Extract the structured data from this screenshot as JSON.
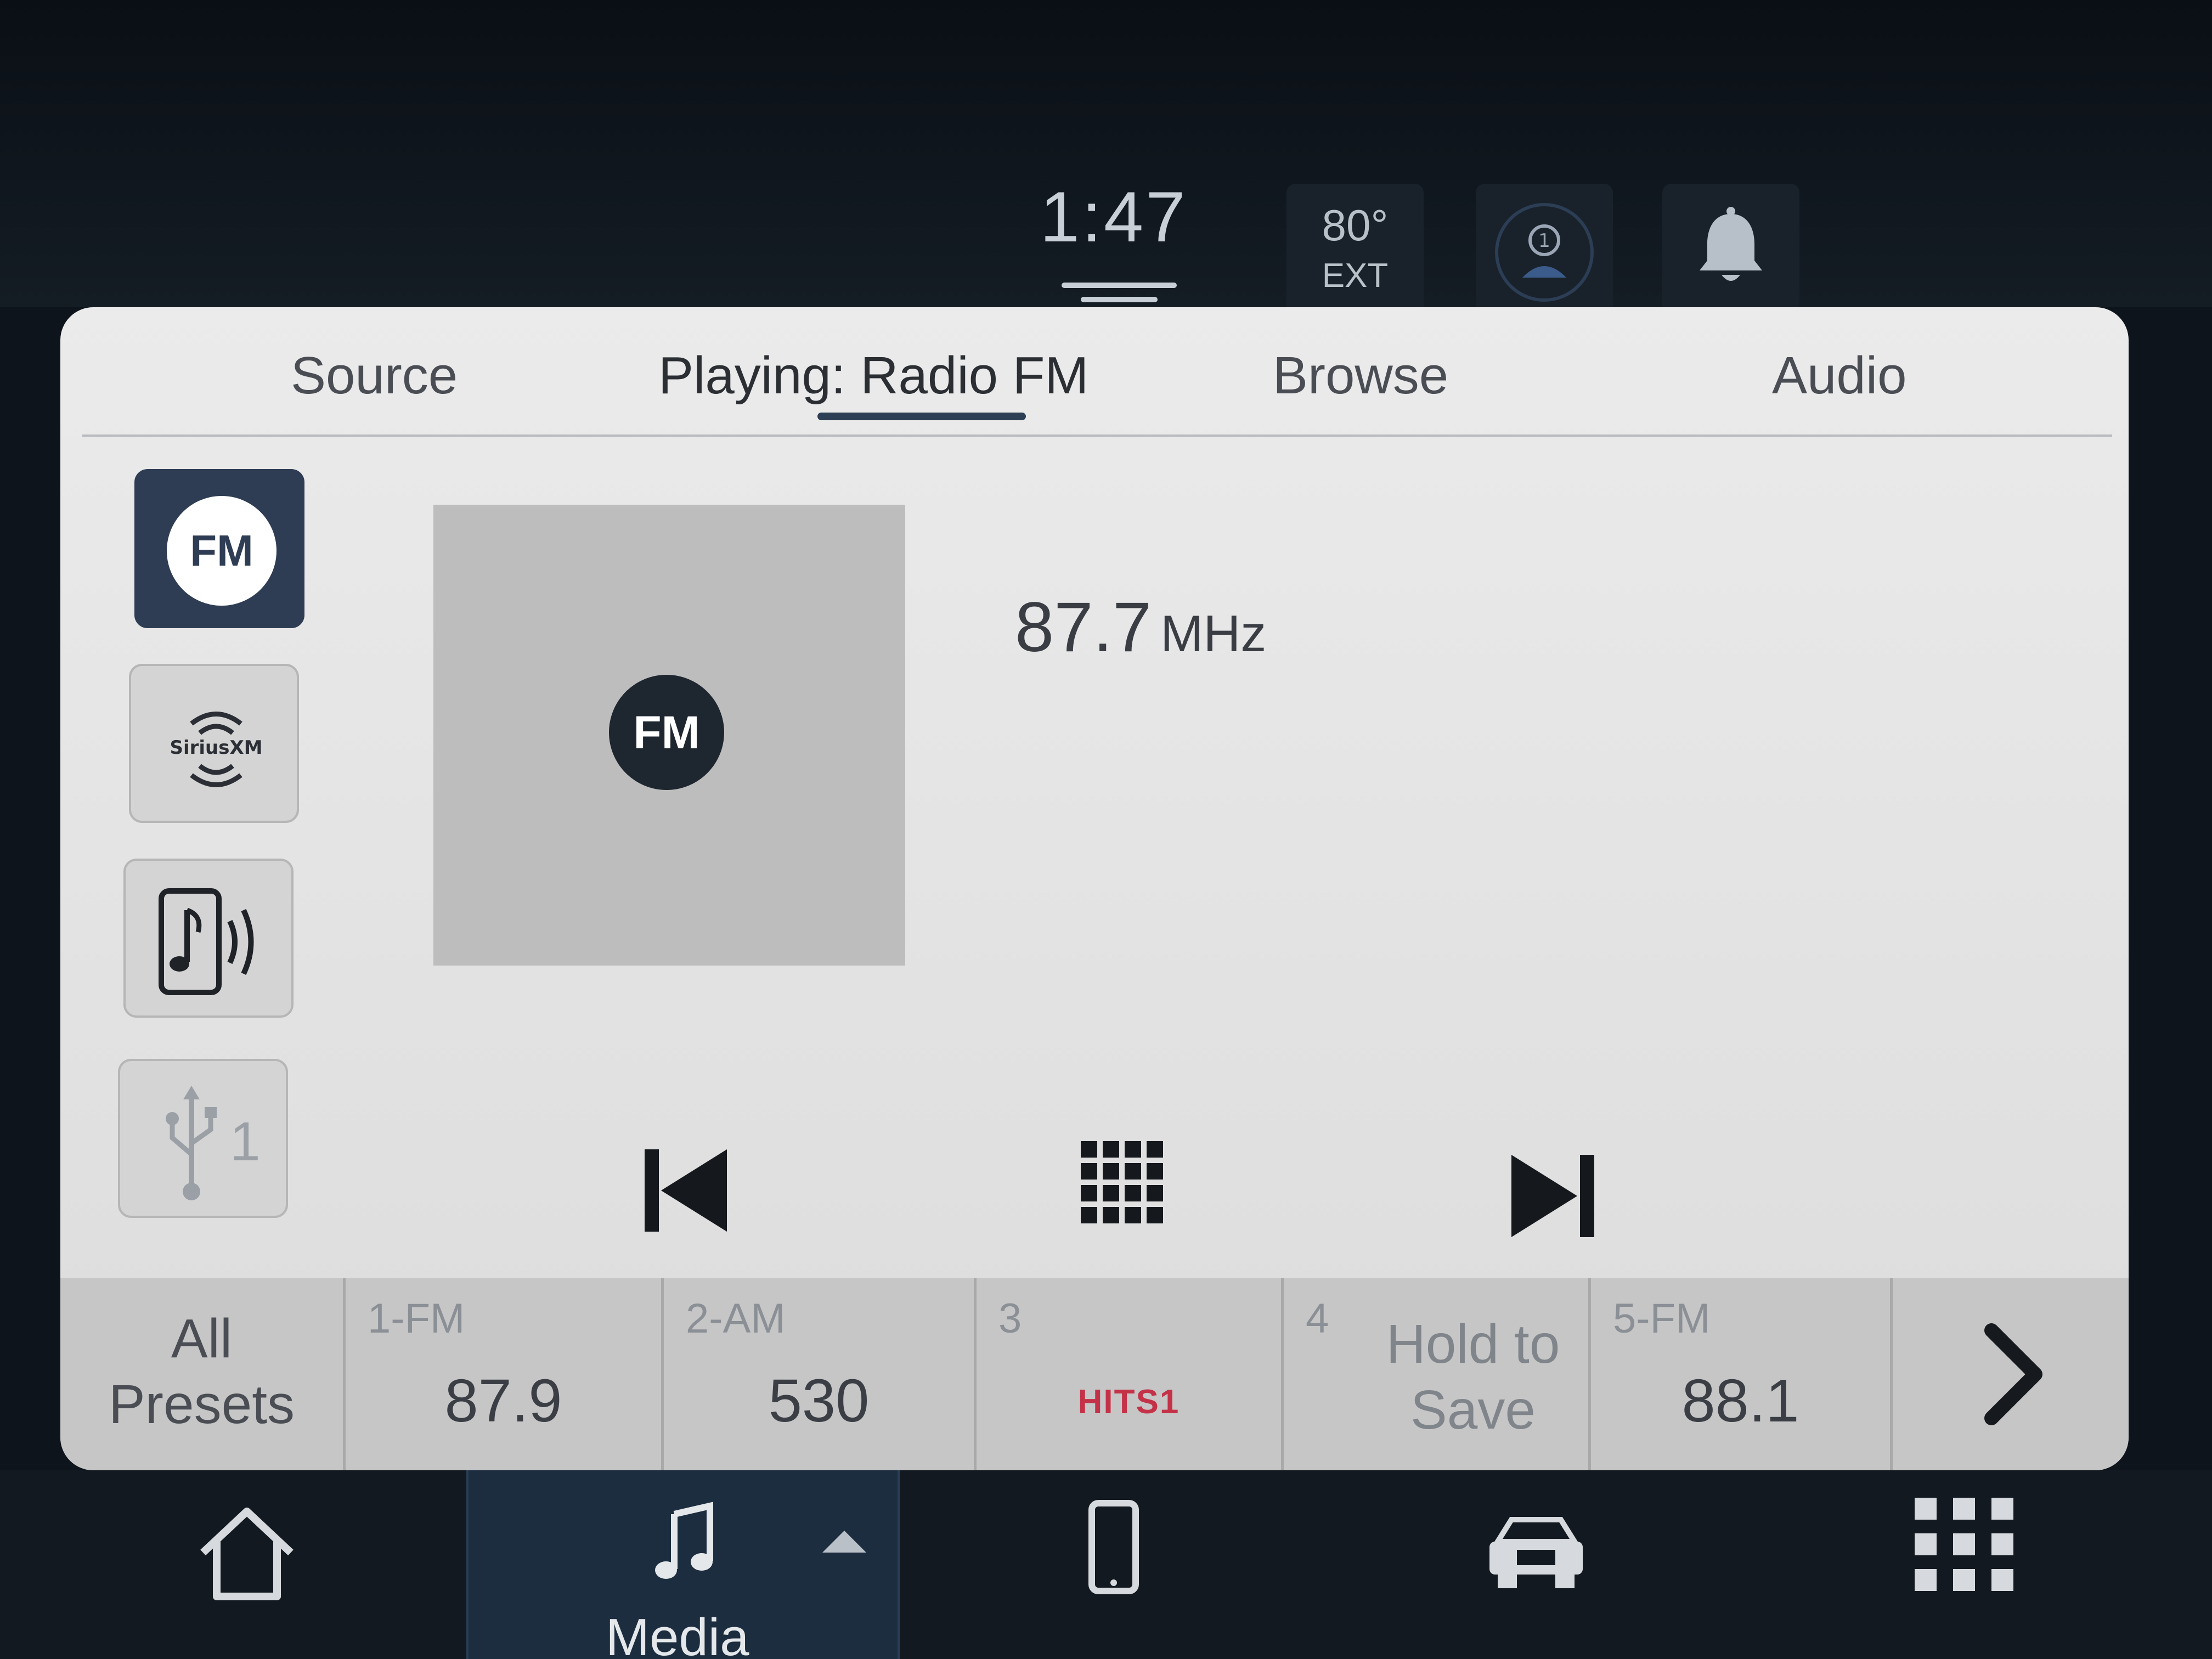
{
  "status": {
    "time": "1:47",
    "temperature": "80°",
    "temperature_label": "EXT",
    "driver_profile_number": "1"
  },
  "tabs": {
    "source": "Source",
    "playing": "Playing: Radio FM",
    "browse": "Browse",
    "audio": "Audio"
  },
  "sources": {
    "fm": "FM",
    "siriusxm": "SiriusXM",
    "usb_number": "1"
  },
  "now_playing": {
    "art_label": "FM",
    "frequency": "87.7",
    "unit": "MHz"
  },
  "presets": {
    "all_line1": "All",
    "all_line2": "Presets",
    "items": [
      {
        "num": "1-FM",
        "value": "87.9"
      },
      {
        "num": "2-AM",
        "value": "530"
      },
      {
        "num": "3",
        "logo": "HITS1"
      },
      {
        "num": "4",
        "hold_line1": "Hold to",
        "hold_line2": "Save"
      },
      {
        "num": "5-FM",
        "value": "88.1"
      }
    ]
  },
  "bottom_nav": {
    "media_label": "Media"
  },
  "colors": {
    "accent": "#2e3d54",
    "panel": "#e4e4e4",
    "hits_logo": "#c43248"
  }
}
